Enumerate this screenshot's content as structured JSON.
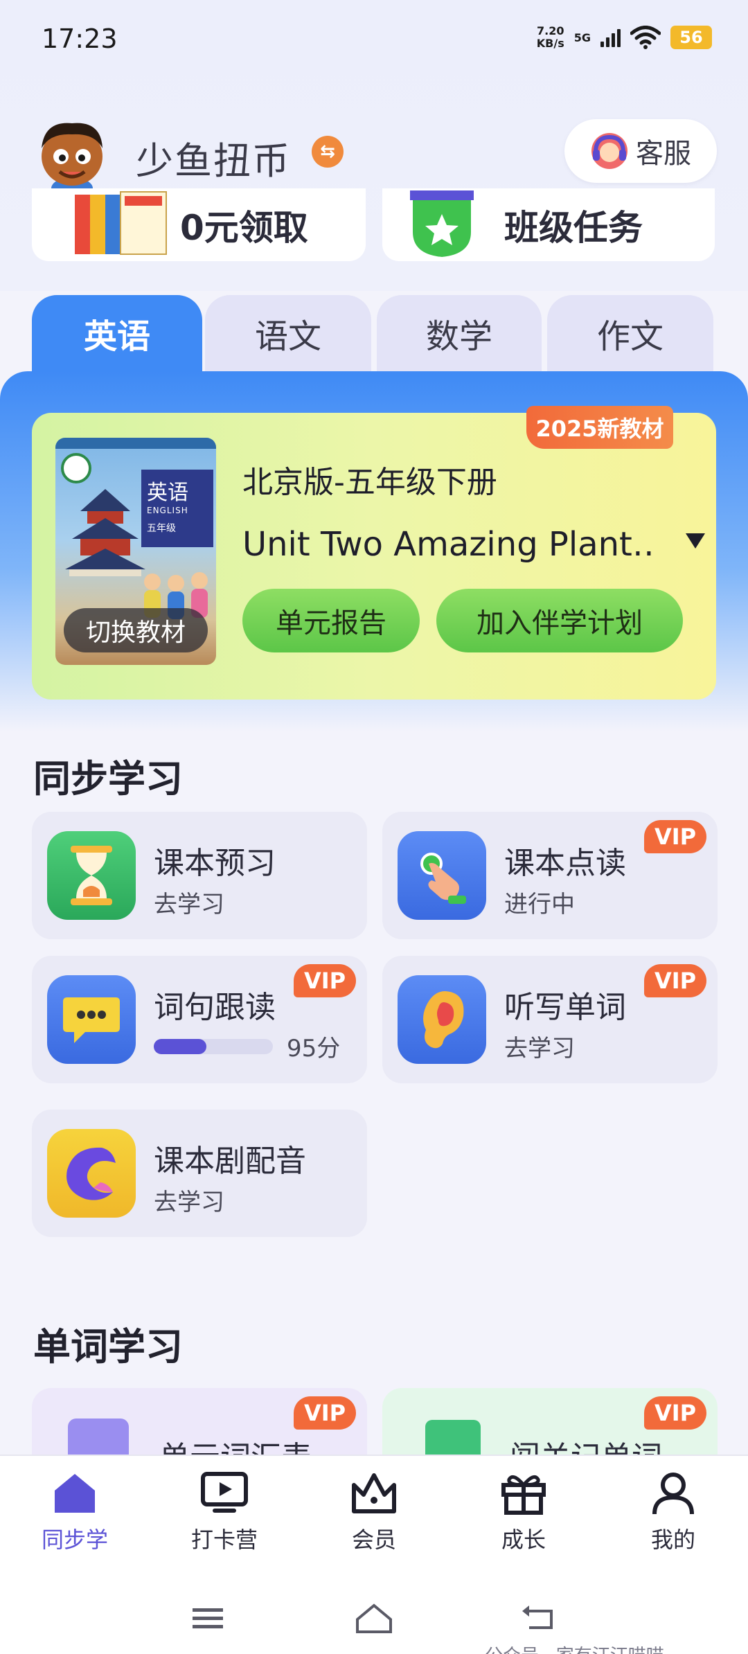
{
  "status_bar": {
    "time": "17:23",
    "net_speed_value": "7.20",
    "net_speed_unit": "KB/s",
    "network": "5G",
    "battery": "56"
  },
  "header": {
    "app_name": "少鱼扭币",
    "service_label": "客服"
  },
  "promo": {
    "left_label": "0元领取",
    "right_label": "班级任务"
  },
  "tabs": [
    {
      "label": "英语",
      "active": true
    },
    {
      "label": "语文",
      "active": false
    },
    {
      "label": "数学",
      "active": false
    },
    {
      "label": "作文",
      "active": false
    }
  ],
  "book": {
    "badge": "2025新教材",
    "edition": "北京版-五年级下册",
    "unit": "Unit Two Amazing Plant…",
    "switch_label": "切换教材",
    "cover_title": "英语",
    "cover_subtitle": "ENGLISH",
    "cover_grade": "五年级",
    "report_button": "单元报告",
    "plan_button": "加入伴学计划"
  },
  "sync_study": {
    "title": "同步学习",
    "items": [
      {
        "title": "课本预习",
        "subtitle": "去学习",
        "vip": false
      },
      {
        "title": "课本点读",
        "subtitle": "进行中",
        "vip": true,
        "vip_label": "VIP"
      },
      {
        "title": "词句跟读",
        "score": "95分",
        "progress": 0.44,
        "vip": true,
        "vip_label": "VIP"
      },
      {
        "title": "听写单词",
        "subtitle": "去学习",
        "vip": true,
        "vip_label": "VIP"
      },
      {
        "title": "课本剧配音",
        "subtitle": "去学习",
        "vip": false
      }
    ]
  },
  "word_study": {
    "title": "单词学习",
    "items": [
      {
        "title": "单元词汇表",
        "vip_label": "VIP"
      },
      {
        "title": "闯关记单词",
        "vip_label": "VIP"
      }
    ]
  },
  "bottom_nav": [
    {
      "label": "同步学",
      "icon": "home-icon",
      "active": true
    },
    {
      "label": "打卡营",
      "icon": "tv-icon",
      "active": false
    },
    {
      "label": "会员",
      "icon": "crown-icon",
      "active": false
    },
    {
      "label": "成长",
      "icon": "gift-icon",
      "active": false
    },
    {
      "label": "我的",
      "icon": "person-icon",
      "active": false
    }
  ],
  "watermark": "公众号 · 家有汪汪喵喵",
  "colors": {
    "accent_blue": "#3f8af5",
    "vip_orange": "#f26a3a",
    "active_nav": "#5b52d6",
    "green_button": "#5cc648"
  }
}
